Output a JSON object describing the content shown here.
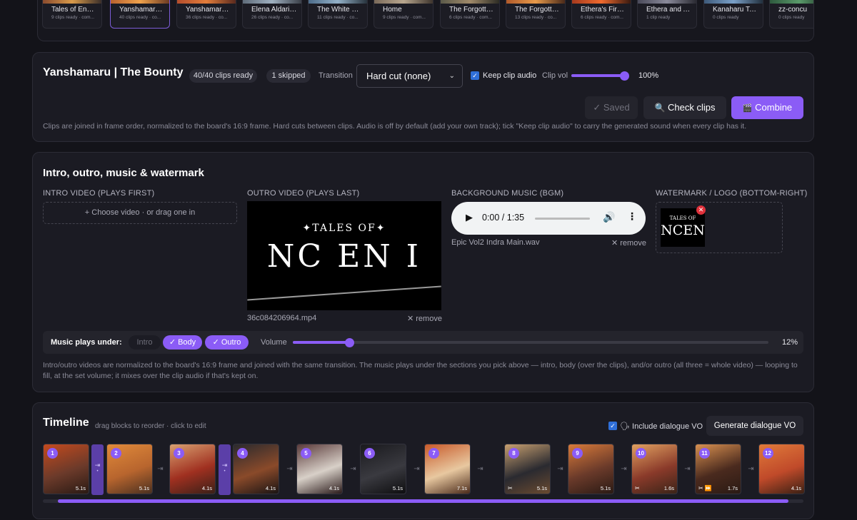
{
  "boards": [
    {
      "name": "Tales of Encen...",
      "sub": "9 clips ready · com...",
      "colors": [
        "#8a4b2e",
        "#d99a4a",
        "#3a2f2a"
      ]
    },
    {
      "name": "Yanshamaru | ...",
      "sub": "40 clips ready · co...",
      "colors": [
        "#b8612f",
        "#f0a24c",
        "#6b3a22"
      ]
    },
    {
      "name": "Yanshamaru | ...",
      "sub": "36 clips ready · co...",
      "colors": [
        "#b44d2c",
        "#e37d3b",
        "#5a2a1e"
      ]
    },
    {
      "name": "Elena Aldarion ...",
      "sub": "26 clips ready · co...",
      "colors": [
        "#5f6c7a",
        "#9fb0c0",
        "#3a3f48"
      ]
    },
    {
      "name": "The White Fang",
      "sub": "11 clips ready · co...",
      "colors": [
        "#4d6c8a",
        "#93b1c8",
        "#28333d"
      ]
    },
    {
      "name": "Home",
      "sub": "9 clips ready · com...",
      "colors": [
        "#7a6a5a",
        "#b9a78f",
        "#3e352d"
      ]
    },
    {
      "name": "The Forgotten ...",
      "sub": "6 clips ready · com...",
      "colors": [
        "#5b5a4a",
        "#a08a6a",
        "#2d2c24"
      ]
    },
    {
      "name": "The Forgotten ...",
      "sub": "13 clips ready · co...",
      "colors": [
        "#b05a2a",
        "#e89a4a",
        "#4a2a1a"
      ]
    },
    {
      "name": "Ethera's Fire —...",
      "sub": "6 clips ready · com...",
      "colors": [
        "#a63a1e",
        "#f06a2e",
        "#3a1a10"
      ]
    },
    {
      "name": "Ethera and An...",
      "sub": "1 clip ready",
      "colors": [
        "#4a4a5a",
        "#8a8a9a",
        "#2a2a32"
      ]
    },
    {
      "name": "Kanaharu Take...",
      "sub": "0 clips ready",
      "colors": [
        "#3e5a7a",
        "#7aa0c8",
        "#22303e"
      ]
    },
    {
      "name": "zz-concu",
      "sub": "0 clips ready",
      "colors": [
        "#2e5a3e",
        "#5a9a6a",
        "#1a2e22"
      ]
    }
  ],
  "project": {
    "title": "Yanshamaru | The Bounty",
    "clips_ready": "40/40 clips ready",
    "skipped": "1 skipped",
    "transition_label": "Transition",
    "transition_value": "Hard cut (none)",
    "keep_audio_label": "Keep clip audio",
    "keep_audio_checked": true,
    "clip_vol_label": "Clip vol",
    "clip_vol_value": "100%",
    "clip_vol_level": 1.0,
    "saved_label": "✓ Saved",
    "check_label": "Check clips",
    "combine_label": "Combine",
    "note": "Clips are joined in frame order, normalized to the board's 16:9 frame. Hard cuts between clips. Audio is off by default (add your own track); tick \"Keep clip audio\" to carry the generated sound when every clip has it."
  },
  "media": {
    "title": "Intro, outro, music & watermark",
    "intro_label": "INTRO VIDEO (PLAYS FIRST)",
    "intro_drop": "+ Choose video · or drag one in",
    "outro_label": "OUTRO VIDEO (PLAYS LAST)",
    "outro_file": "36c084206964.mp4",
    "outro_logo_top": "TALES OF",
    "outro_logo_main": "NC EN I",
    "remove_label": "✕ remove",
    "bgm_label": "BACKGROUND MUSIC (BGM)",
    "bgm_time": "0:00 / 1:35",
    "bgm_file": "Epic Vol2 Indra Main.wav",
    "watermark_label": "WATERMARK / LOGO (BOTTOM-RIGHT)",
    "watermark_logo_top": "TALES OF",
    "watermark_logo_main": "NCEN",
    "music_plays_label": "Music plays under:",
    "music_intro": "Intro",
    "music_body": "✓ Body",
    "music_outro": "✓ Outro",
    "volume_label": "Volume",
    "volume_value": "12%",
    "volume_level": 0.12,
    "note": "Intro/outro videos are normalized to the board's 16:9 frame and joined with the same transition. The music plays under the sections you pick above — intro, body (over the clips), and/or outro (all three = whole video) — looping to fill, at the set volume; it mixes over the clip audio if that's kept on."
  },
  "timeline": {
    "title": "Timeline",
    "subtitle": "drag blocks to reorder · click to edit",
    "include_vo_label": "🗣 Include dialogue VO",
    "include_vo_checked": true,
    "generate_vo_label": "Generate dialogue VO",
    "clips": [
      {
        "num": "1",
        "dur": "5.1s",
        "fx": "",
        "colors": [
          "#c44a1e",
          "#6b3a2a",
          "#2a1a14"
        ]
      },
      {
        "num": "2",
        "dur": "5.1s",
        "fx": "",
        "colors": [
          "#e08a3a",
          "#b8652e",
          "#4a3020"
        ]
      },
      {
        "num": "3",
        "dur": "4.1s",
        "fx": "",
        "colors": [
          "#d8a070",
          "#a03020",
          "#3a2018"
        ]
      },
      {
        "num": "4",
        "dur": "4.1s",
        "fx": "",
        "colors": [
          "#2a2a2e",
          "#8a4a2a",
          "#1a1414"
        ]
      },
      {
        "num": "5",
        "dur": "4.1s",
        "fx": "",
        "colors": [
          "#5a3a3a",
          "#d8d0c8",
          "#2a1a1a"
        ]
      },
      {
        "num": "6",
        "dur": "5.1s",
        "fx": "",
        "colors": [
          "#1a1a1e",
          "#3a3a40",
          "#0e0e10"
        ]
      },
      {
        "num": "7",
        "dur": "7.1s",
        "fx": "",
        "colors": [
          "#c85a2a",
          "#e8c8a0",
          "#4a2a1a"
        ]
      },
      {
        "num": "8",
        "dur": "5.1s",
        "fx": "✂",
        "colors": [
          "#c8a070",
          "#2a2a30",
          "#6a4a30"
        ]
      },
      {
        "num": "9",
        "dur": "5.1s",
        "fx": "",
        "colors": [
          "#d87a3a",
          "#6a3a2a",
          "#2a1a14"
        ]
      },
      {
        "num": "10",
        "dur": "1.6s",
        "fx": "✂",
        "colors": [
          "#e0a060",
          "#8a3a2a",
          "#3a2418"
        ]
      },
      {
        "num": "11",
        "dur": "1.7s",
        "fx": "✂ ⏩",
        "colors": [
          "#d89050",
          "#4a2a1e",
          "#2a1a14"
        ]
      },
      {
        "num": "12",
        "dur": "4.1s",
        "fx": "",
        "colors": [
          "#e07a3a",
          "#c04a2a",
          "#3a2014"
        ]
      }
    ],
    "progress": 0.98
  }
}
